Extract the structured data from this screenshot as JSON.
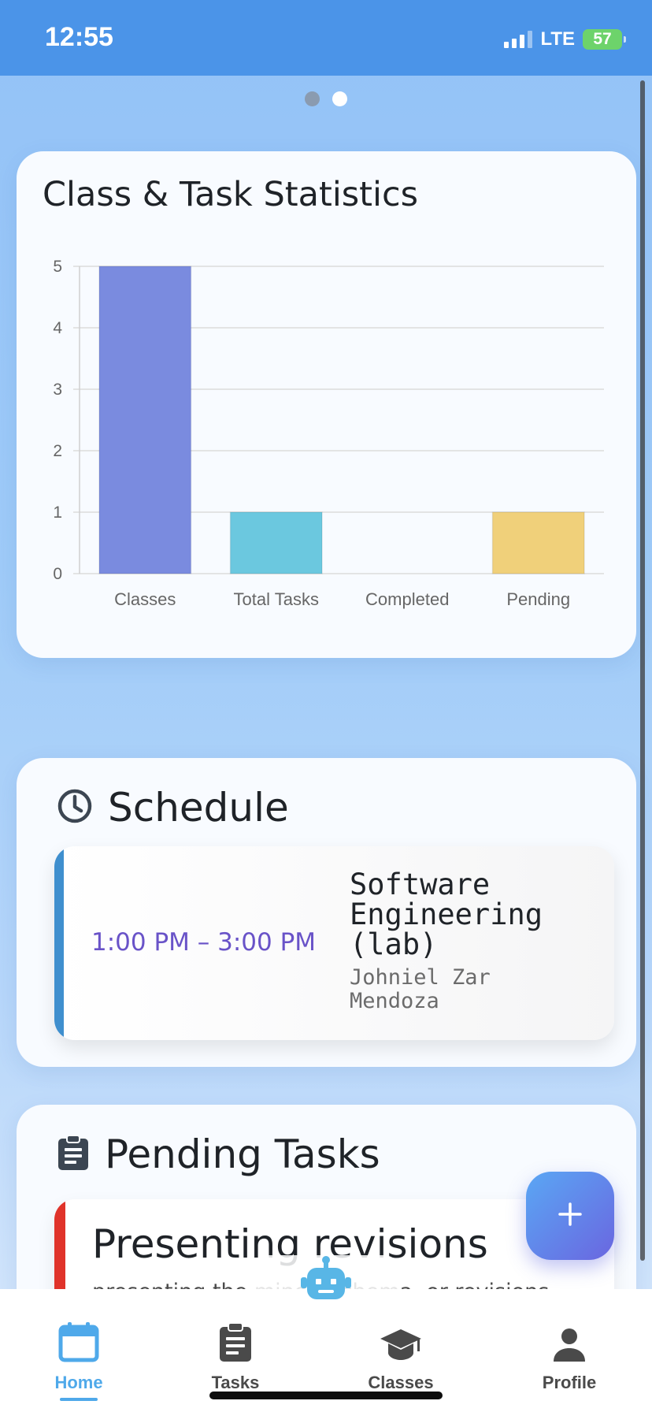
{
  "status_bar": {
    "time": "12:55",
    "network": "LTE",
    "battery": "57"
  },
  "pager": {
    "count": 2,
    "active_index": 1
  },
  "stats_card": {
    "title": "Class & Task Statistics"
  },
  "chart_data": {
    "type": "bar",
    "title": "",
    "categories": [
      "Classes",
      "Total Tasks",
      "Completed",
      "Pending"
    ],
    "values": [
      5,
      1,
      0,
      1
    ],
    "colors": [
      "#7a8bdf",
      "#6bc8df",
      "#e3a5b8",
      "#f0d07a"
    ],
    "ylim": [
      0,
      5
    ],
    "yticks": [
      "0",
      "1",
      "2",
      "3",
      "4",
      "5"
    ],
    "grid": true,
    "legend": "none",
    "xlabel": "",
    "ylabel": ""
  },
  "schedule": {
    "title": "Schedule",
    "items": [
      {
        "time": "1:00 PM – 3:00 PM",
        "course": "Software Engineering (lab)",
        "teacher": "Johniel Zar Mendoza",
        "accent": "#3f8fce"
      }
    ]
  },
  "pending_tasks": {
    "title": "Pending Tasks",
    "items": [
      {
        "title": "Presenting revisions",
        "description": "presenting the minor, schema, or revisions",
        "accent": "#e0332a"
      }
    ]
  },
  "fab": {
    "icon": "plus-icon"
  },
  "bot": {
    "icon": "robot-icon"
  },
  "bottom_nav": {
    "items": [
      {
        "label": "Home",
        "icon": "calendar-icon",
        "active": true
      },
      {
        "label": "Tasks",
        "icon": "clipboard-icon",
        "active": false
      },
      {
        "label": "Classes",
        "icon": "graduation-cap-icon",
        "active": false
      },
      {
        "label": "Profile",
        "icon": "person-icon",
        "active": false
      }
    ]
  },
  "colors": {
    "accent": "#4fa9ea",
    "status_bar": "#4b94e8",
    "schedule_time": "#6953c8"
  }
}
